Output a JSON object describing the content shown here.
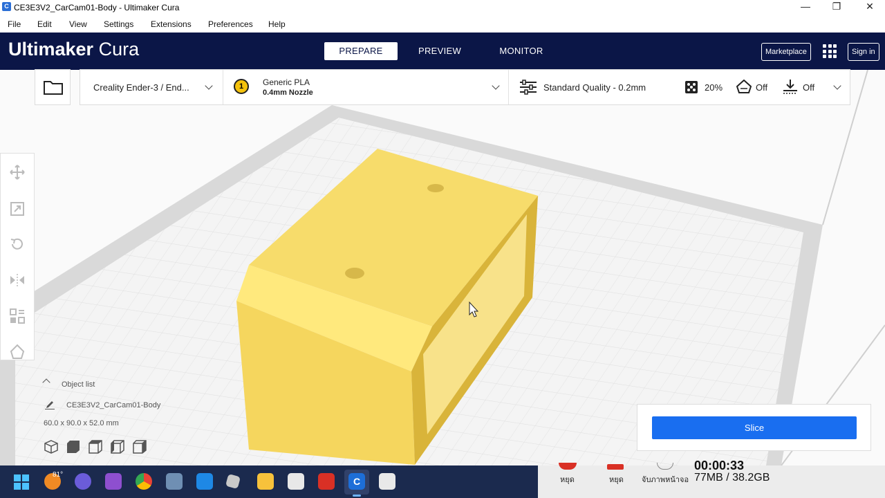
{
  "window": {
    "title": "CE3E3V2_CarCam01-Body - Ultimaker Cura",
    "controls": [
      "—",
      "❐",
      "✕"
    ]
  },
  "menu": [
    "File",
    "Edit",
    "View",
    "Settings",
    "Extensions",
    "Preferences",
    "Help"
  ],
  "header": {
    "brand_bold": "Ultimaker",
    "brand_light": "Cura",
    "stages": [
      "PREPARE",
      "PREVIEW",
      "MONITOR"
    ],
    "active_stage": "PREPARE",
    "marketplace_label": "Marketplace",
    "signin_label": "Sign in"
  },
  "printer": {
    "name": "Creality Ender-3 / End..."
  },
  "material": {
    "extruder_number": "1",
    "name": "Generic PLA",
    "nozzle": "0.4mm Nozzle"
  },
  "print_settings": {
    "quality": "Standard Quality - 0.2mm",
    "infill": "20%",
    "support": "Off",
    "adhesion": "Off"
  },
  "object_list": {
    "header": "Object list",
    "object_name": "CE3E3V2_CarCam01-Body",
    "dimensions": "60.0 x 90.0 x 52.0 mm"
  },
  "slice": {
    "label": "Slice"
  },
  "taskbar": {
    "weather_temp": "81°"
  },
  "tray": {
    "labels": [
      "หยุด",
      "หยุด",
      "จับภาพหน้าจอ"
    ],
    "memory": "77MB / 38.2GB",
    "timer": "00:00:33"
  },
  "colors": {
    "header_bg": "#0b1647",
    "accent": "#196ef0",
    "model": "#f7dc6b",
    "build_plate": "#f2f2f2"
  }
}
